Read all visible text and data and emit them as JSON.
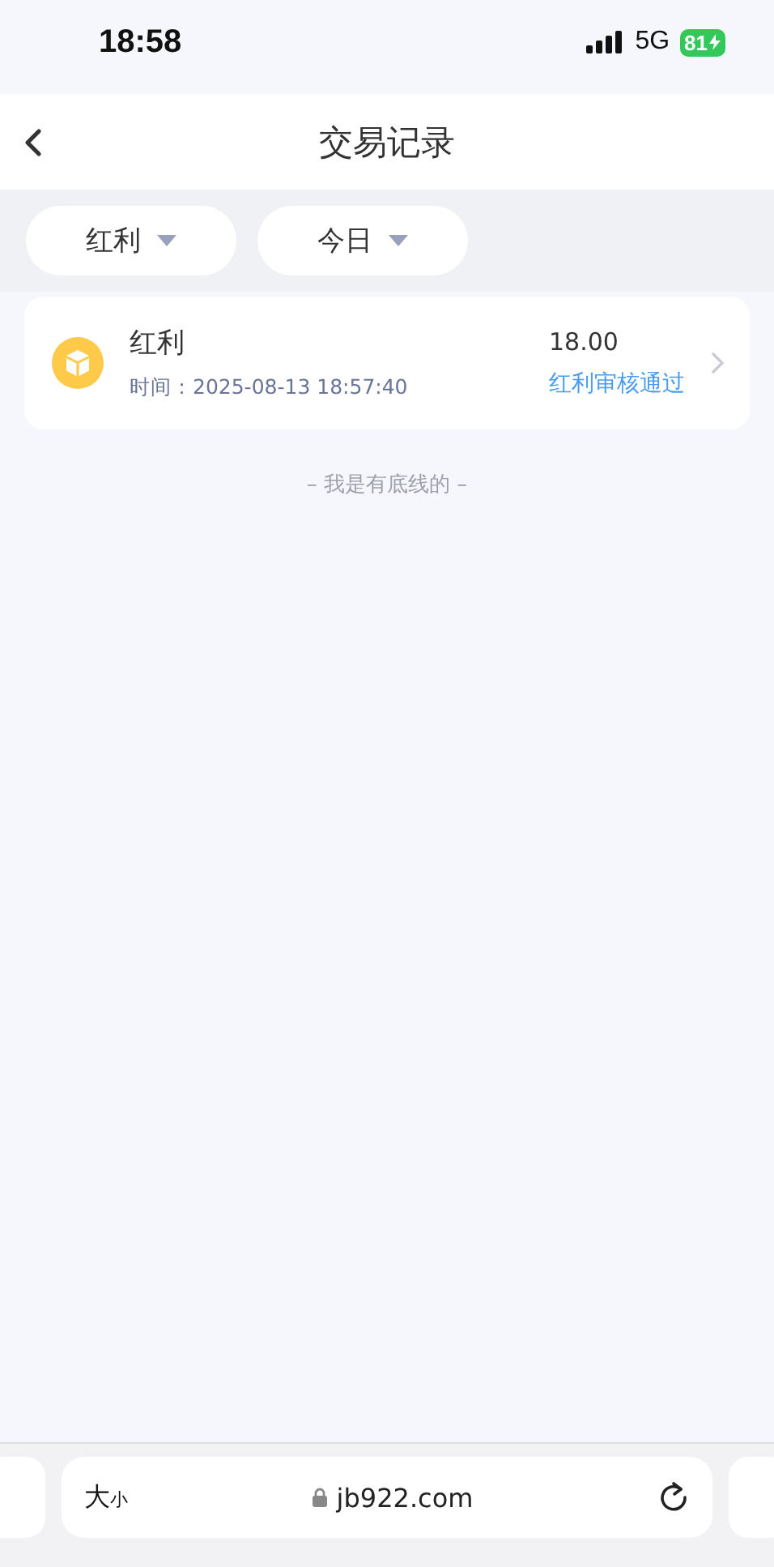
{
  "status_bar": {
    "time": "18:58",
    "network": "5G",
    "battery": "81"
  },
  "nav": {
    "title": "交易记录"
  },
  "filters": [
    {
      "label": "红利"
    },
    {
      "label": "今日"
    }
  ],
  "records": [
    {
      "title": "红利",
      "time": "时间：2025-08-13 18:57:40",
      "amount": "18.00",
      "status": "红利审核通过"
    }
  ],
  "end_note": "– 我是有底线的 –",
  "browser": {
    "text_size_large": "大",
    "text_size_small": "小",
    "url": "jb922.com"
  }
}
